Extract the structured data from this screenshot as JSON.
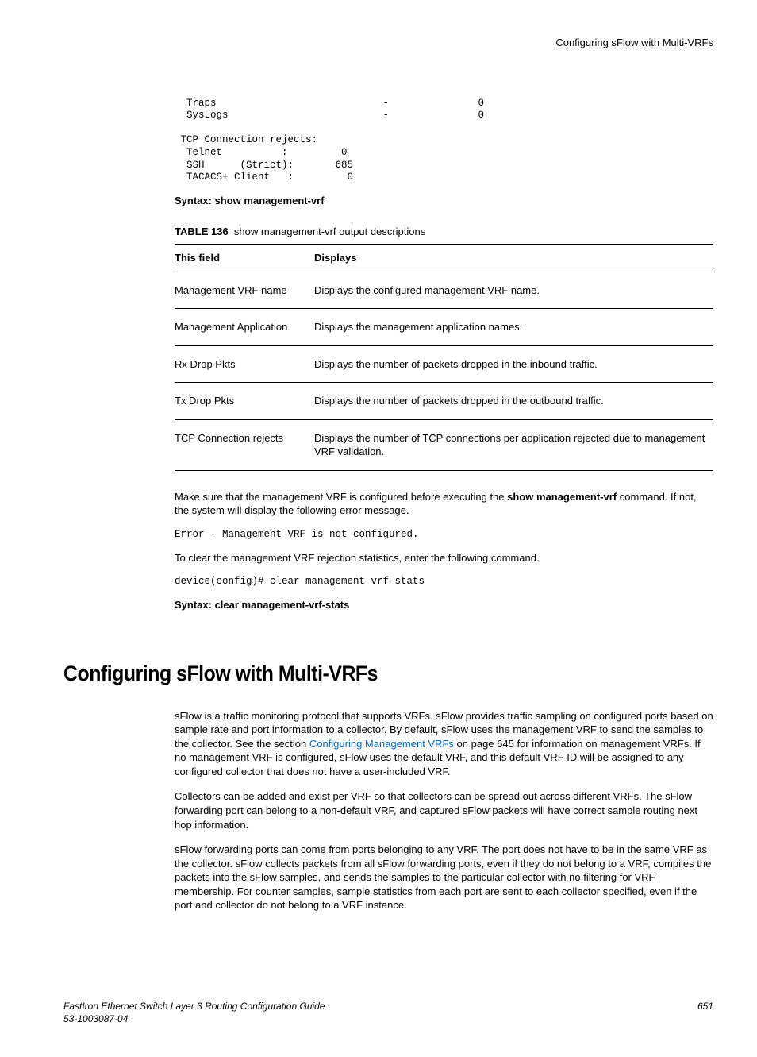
{
  "header": {
    "running_title": "Configuring sFlow with Multi-VRFs"
  },
  "cli_output": "  Traps                            -               0\n  SysLogs                          -               0\n\n TCP Connection rejects:\n  Telnet          :         0\n  SSH      (Strict):       685\n  TACACS+ Client   :         0",
  "syntax1": "Syntax: show management-vrf",
  "table": {
    "number": "TABLE 136",
    "title": "show management-vrf output descriptions",
    "head_field": "This field",
    "head_displays": "Displays",
    "rows": [
      {
        "field": "Management VRF name",
        "displays": "Displays the configured management VRF name."
      },
      {
        "field": "Management Application",
        "displays": "Displays the management application names."
      },
      {
        "field": "Rx Drop Pkts",
        "displays": "Displays the number of packets dropped in the inbound traffic."
      },
      {
        "field": "Tx Drop Pkts",
        "displays": "Displays the number of packets dropped in the outbound traffic."
      },
      {
        "field": "TCP Connection rejects",
        "displays": "Displays the number of TCP connections per application rejected due to management VRF validation."
      }
    ]
  },
  "para1_pre": "Make sure that the management VRF is configured before executing the ",
  "para1_bold": "show management-vrf",
  "para1_post": " command. If not, the system will display the following error message.",
  "error_output": "Error - Management VRF is not configured.",
  "para2": "To clear the management VRF rejection statistics, enter the following command.",
  "clear_cmd": "device(config)# clear management-vrf-stats",
  "syntax2": "Syntax: clear management-vrf-stats",
  "section_title": "Configuring sFlow with Multi-VRFs",
  "body1_pre": "sFlow is a traffic monitoring protocol that supports VRFs. sFlow provides traffic sampling on configured ports based on sample rate and port information to a collector. By default, sFlow uses the management VRF to send the samples to the collector. See the section ",
  "body1_link": "Configuring Management VRFs",
  "body1_post": " on page 645 for information on management VRFs. If no management VRF is configured, sFlow uses the default VRF, and this default VRF ID will be assigned to any configured collector that does not have a user-included VRF.",
  "body2": "Collectors can be added and exist per VRF so that collectors can be spread out across different VRFs. The sFlow forwarding port can belong to a non-default VRF, and captured sFlow packets will have correct sample routing next hop information.",
  "body3": "sFlow forwarding ports can come from ports belonging to any VRF. The port does not have to be in the same VRF as the collector. sFlow collects packets from all sFlow forwarding ports, even if they do not belong to a VRF, compiles the packets into the sFlow samples, and sends the samples to the particular collector with no filtering for VRF membership. For counter samples, sample statistics from each port are sent to each collector specified, even if the port and collector do not belong to a VRF instance.",
  "footer": {
    "guide": "FastIron Ethernet Switch Layer 3 Routing Configuration Guide",
    "docnum": "53-1003087-04",
    "page": "651"
  }
}
